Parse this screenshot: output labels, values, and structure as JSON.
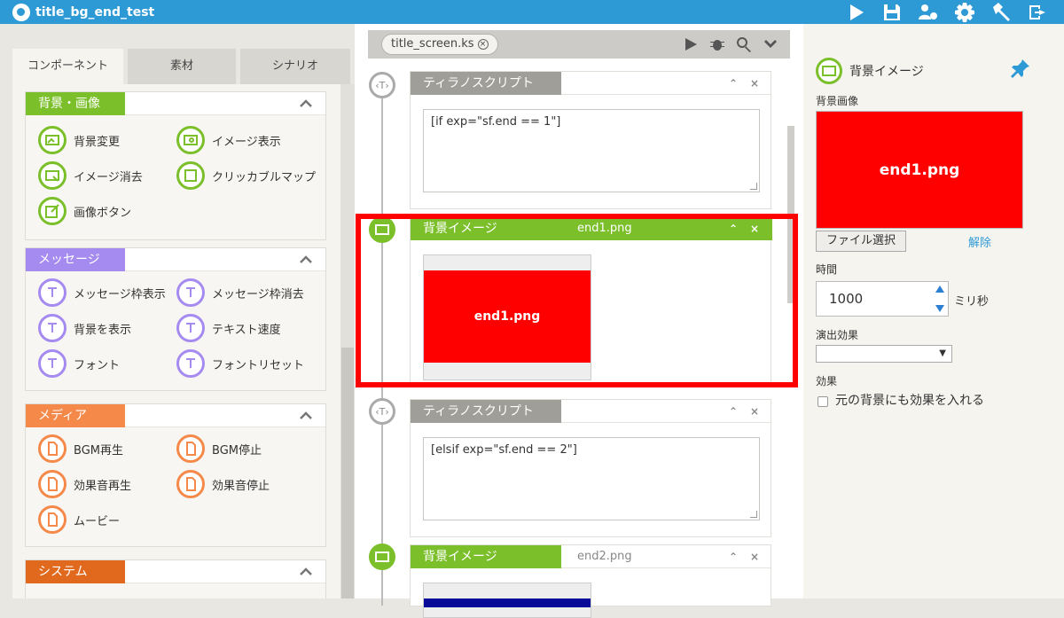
{
  "app": {
    "title": "title_bg_end_test"
  },
  "toolbar": {
    "icons": [
      "play-icon",
      "save-icon",
      "people-gear-icon",
      "gear-icon",
      "hammer-icon",
      "export-icon"
    ]
  },
  "left": {
    "tabs": [
      "コンポーネント",
      "素材",
      "シナリオ"
    ],
    "sections": [
      {
        "title": "背景・画像",
        "color": "#7bbf2a",
        "items": [
          "背景変更",
          "イメージ表示",
          "イメージ消去",
          "クリッカブルマップ",
          "画像ボタン"
        ]
      },
      {
        "title": "メッセージ",
        "color": "#a58bf0",
        "items": [
          "メッセージ枠表示",
          "メッセージ枠消去",
          "背景を表示",
          "テキスト速度",
          "フォント",
          "フォントリセット"
        ]
      },
      {
        "title": "メディア",
        "color": "#f4894a",
        "items": [
          "BGM再生",
          "BGM停止",
          "効果音再生",
          "効果音停止",
          "ムービー"
        ]
      },
      {
        "title": "システム",
        "color": "#e0691e",
        "items": []
      }
    ]
  },
  "center": {
    "file_tab": "title_screen.ks",
    "cards": [
      {
        "type": "script",
        "title": "ティラノスクリプト",
        "code": "[if exp=\"sf.end == 1\"]"
      },
      {
        "type": "bg",
        "title": "背景イメージ",
        "file": "end1.png",
        "thumb_text": "end1.png"
      },
      {
        "type": "script",
        "title": "ティラノスクリプト",
        "code": "[elsif exp=\"sf.end == 2\"]"
      },
      {
        "type": "bg",
        "title": "背景イメージ",
        "file": "end2.png"
      }
    ]
  },
  "right": {
    "title": "背景イメージ",
    "bg_label": "背景画像",
    "preview_text": "end1.png",
    "file_button": "ファイル選択",
    "clear_link": "解除",
    "time_label": "時間",
    "time_value": "1000",
    "time_unit": "ミリ秒",
    "effect_label": "演出効果",
    "effect_value": "",
    "effects_label": "効果",
    "checkbox_label": "元の背景にも効果を入れる"
  },
  "colors": {
    "accent": "#2d9ad6",
    "green": "#7bbf2a",
    "purple": "#a58bf0",
    "orange": "#f4894a",
    "highlight": "#ff0000"
  }
}
